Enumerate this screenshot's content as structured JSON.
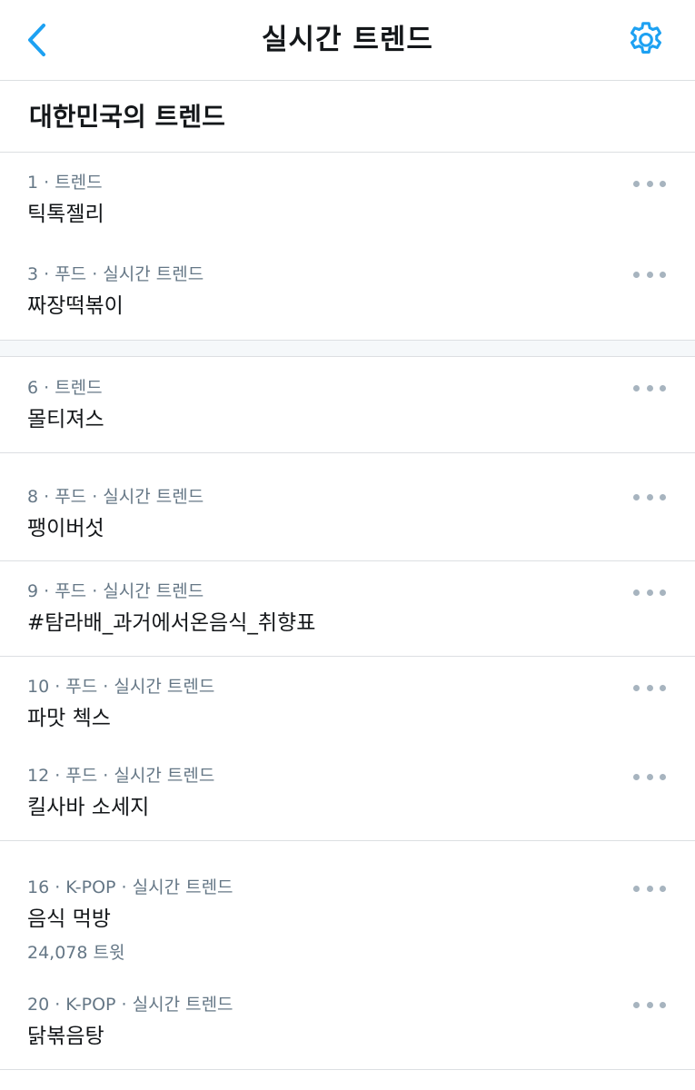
{
  "header": {
    "back_icon": "chevron-left-icon",
    "title": "실시간 트렌드",
    "settings_icon": "gear-icon",
    "accent_color": "#1da1f2"
  },
  "section": {
    "title": "대한민국의 트렌드"
  },
  "trends": [
    {
      "meta": "1 · 트렌드",
      "name": "틱톡젤리"
    },
    {
      "meta": "3 · 푸드 · 실시간 트렌드",
      "name": "짜장떡볶이"
    },
    {
      "meta": "6 · 트렌드",
      "name": "몰티져스"
    },
    {
      "meta": "8 · 푸드 · 실시간 트렌드",
      "name": "팽이버섯"
    },
    {
      "meta": "9 · 푸드 · 실시간 트렌드",
      "name": "#탐라배_과거에서온음식_취향표"
    },
    {
      "meta": "10 · 푸드 · 실시간 트렌드",
      "name": "파맛 첵스"
    },
    {
      "meta": "12 · 푸드 · 실시간 트렌드",
      "name": "킬사바 소세지"
    },
    {
      "meta": "16 · K-POP · 실시간 트렌드",
      "name": "음식 먹방",
      "count": "24,078 트윗"
    },
    {
      "meta": "20 · K-POP · 실시간 트렌드",
      "name": "닭볶음탕"
    }
  ]
}
